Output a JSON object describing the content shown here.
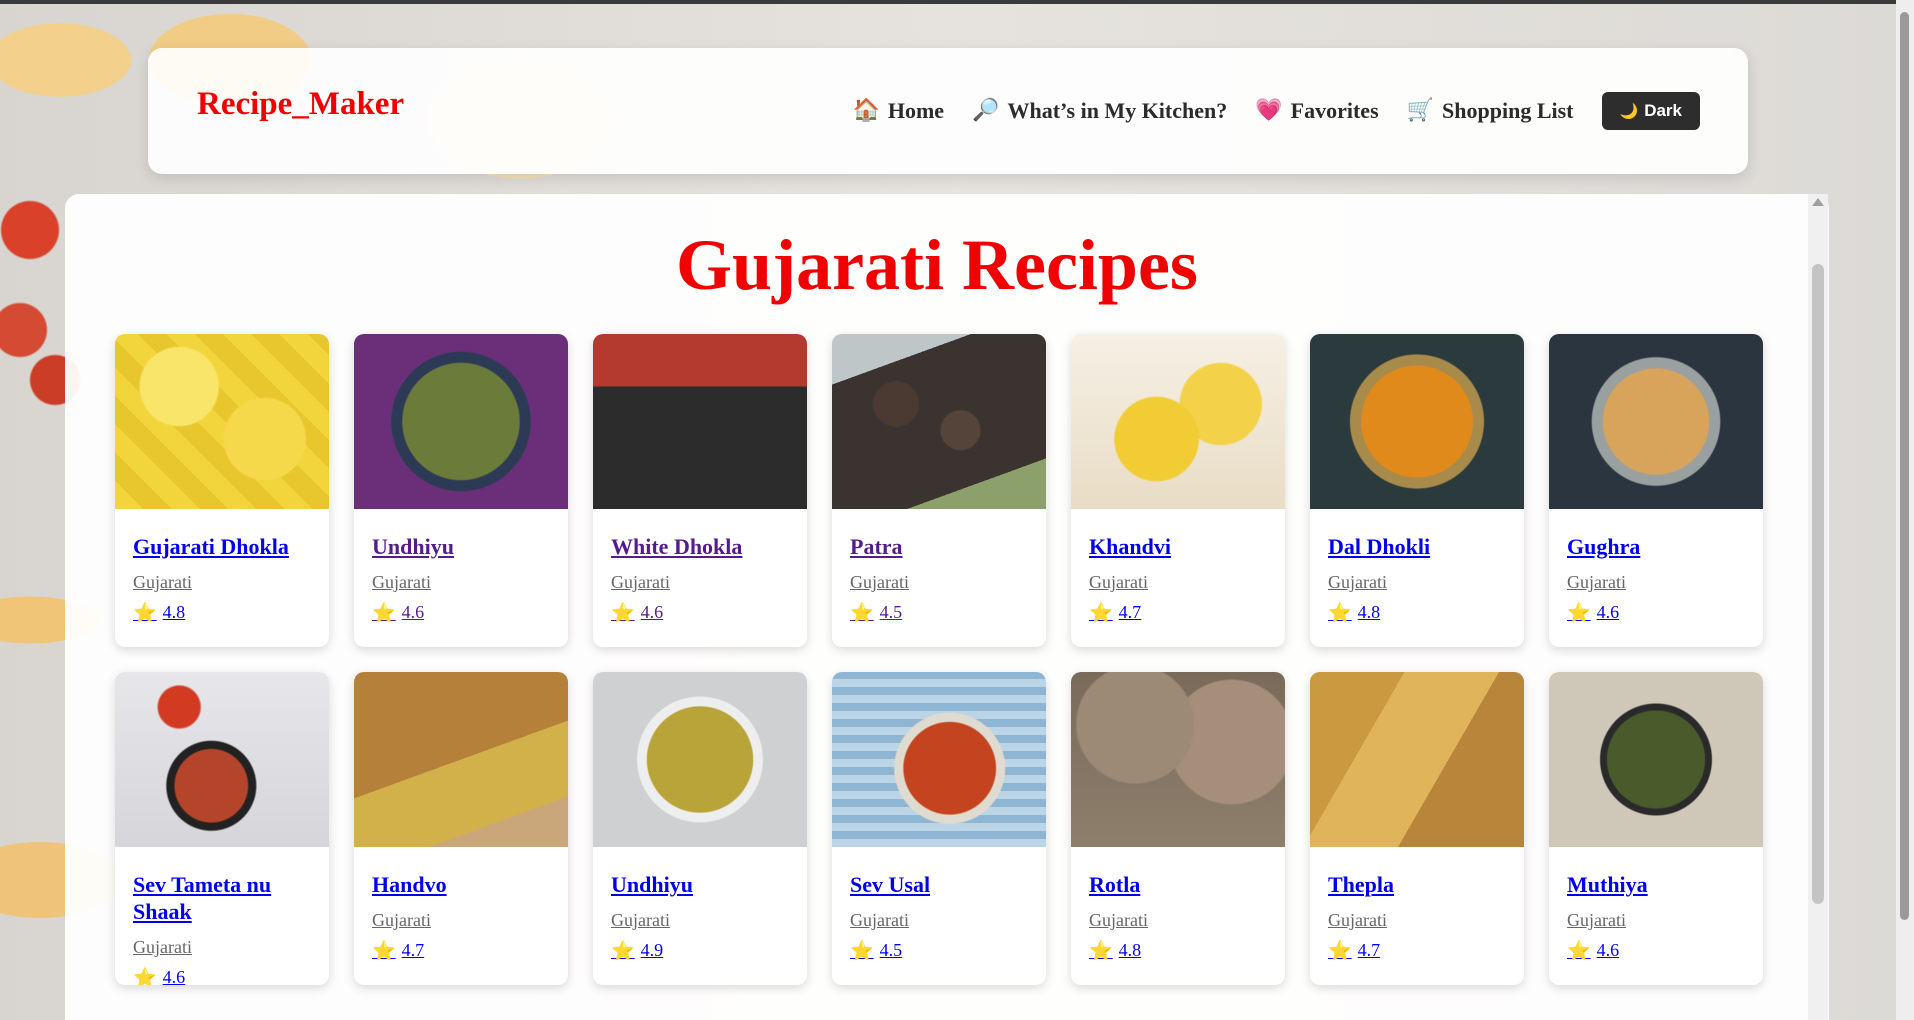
{
  "brand": "Recipe_Maker",
  "nav": {
    "home": {
      "icon": "🏠",
      "label": "Home"
    },
    "kitchen": {
      "icon": "🔎",
      "label": "What’s in My Kitchen?"
    },
    "favorites": {
      "icon": "💗",
      "label": "Favorites"
    },
    "shopping": {
      "icon": "🛒",
      "label": "Shopping List"
    },
    "dark_toggle": {
      "icon": "🌙",
      "label": "Dark"
    }
  },
  "page_title": "Gujarati Recipes",
  "recipes": [
    {
      "name": "Gujarati Dhokla",
      "cuisine": "Gujarati",
      "rating": "4.8",
      "visited": false,
      "image": "dhokla-image"
    },
    {
      "name": "Undhiyu",
      "cuisine": "Gujarati",
      "rating": "4.6",
      "visited": true,
      "image": "undhiyu-image"
    },
    {
      "name": "White Dhokla",
      "cuisine": "Gujarati",
      "rating": "4.6",
      "visited": true,
      "image": "white-dhokla-image"
    },
    {
      "name": "Patra",
      "cuisine": "Gujarati",
      "rating": "4.5",
      "visited": true,
      "image": "patra-image"
    },
    {
      "name": "Khandvi",
      "cuisine": "Gujarati",
      "rating": "4.7",
      "visited": false,
      "image": "khandvi-image"
    },
    {
      "name": "Dal Dhokli",
      "cuisine": "Gujarati",
      "rating": "4.8",
      "visited": false,
      "image": "dal-dhokli-image"
    },
    {
      "name": "Gughra",
      "cuisine": "Gujarati",
      "rating": "4.6",
      "visited": false,
      "image": "gughra-image"
    },
    {
      "name": "Sev Tameta nu Shaak",
      "cuisine": "Gujarati",
      "rating": "4.6",
      "visited": false,
      "image": "sev-tameta-image"
    },
    {
      "name": "Handvo",
      "cuisine": "Gujarati",
      "rating": "4.7",
      "visited": false,
      "image": "handvo-image"
    },
    {
      "name": "Undhiyu",
      "cuisine": "Gujarati",
      "rating": "4.9",
      "visited": false,
      "image": "undhiyu-image"
    },
    {
      "name": "Sev Usal",
      "cuisine": "Gujarati",
      "rating": "4.5",
      "visited": false,
      "image": "sev-usal-image"
    },
    {
      "name": "Rotla",
      "cuisine": "Gujarati",
      "rating": "4.8",
      "visited": false,
      "image": "rotla-image"
    },
    {
      "name": "Thepla",
      "cuisine": "Gujarati",
      "rating": "4.7",
      "visited": false,
      "image": "thepla-image"
    },
    {
      "name": "Muthiya",
      "cuisine": "Gujarati",
      "rating": "4.6",
      "visited": false,
      "image": "muthiya-image"
    }
  ],
  "rating_icon": "⭐"
}
